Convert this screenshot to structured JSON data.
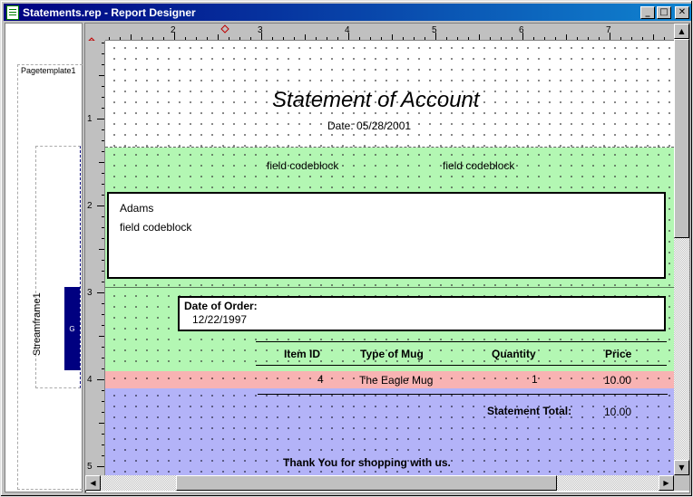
{
  "window": {
    "title": "Statements.rep - Report Designer",
    "buttons": {
      "minimize": "_",
      "maximize": "□",
      "close": "✕"
    }
  },
  "left_panel": {
    "pagetemplate_label": "Pagetemplate1",
    "streamframe_label": "Streamframe1",
    "bar_label": "G"
  },
  "ruler": {
    "horizontal": [
      "2",
      "3",
      "4",
      "5",
      "6",
      "7"
    ],
    "vertical": [
      "1",
      "2",
      "3",
      "4",
      "5"
    ]
  },
  "report": {
    "title": "Statement of Account",
    "date_line": "Date: 05/28/2001",
    "field1": "field codeblock",
    "field2": "field codeblock",
    "customer_name": "Adams",
    "customer_field": "field codeblock",
    "date_of_order_label": "Date of Order:",
    "date_of_order_value": "12/22/1997",
    "columns": [
      "Item ID",
      "Type of Mug",
      "Quantity",
      "Price"
    ],
    "row": {
      "item_id": "4",
      "type": "The Eagle Mug",
      "quantity": "1",
      "price": "10.00"
    },
    "total_label": "Statement Total:",
    "total_value": "10.00",
    "thank_you": "Thank You for shopping with us."
  },
  "colors": {
    "group_band": "#b3f7b3",
    "detail_band": "#f8b3b3",
    "footer_band": "#b3b3f8",
    "titlebar": "#000080"
  }
}
